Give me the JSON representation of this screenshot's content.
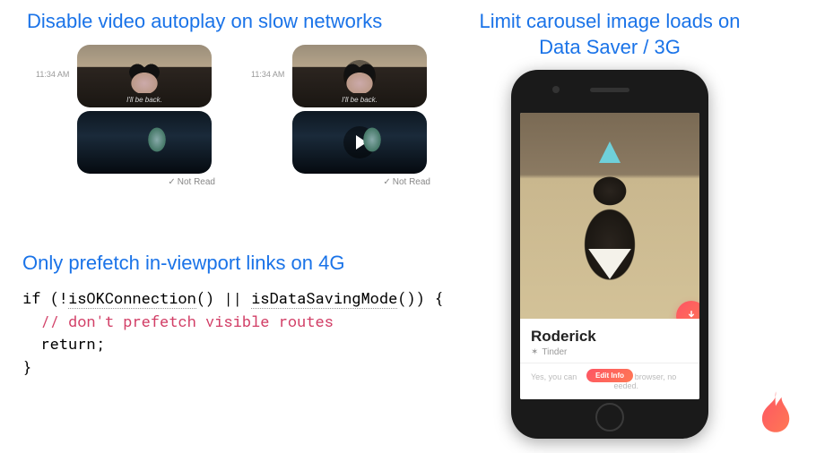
{
  "headings": {
    "autoplay": "Disable video autoplay on slow networks",
    "prefetch": "Only prefetch in-viewport links on 4G",
    "carousel": "Limit carousel image loads on Data Saver / 3G"
  },
  "chat": {
    "timestamp": "11:34 AM",
    "caption1": "I'll be back.",
    "read_status": "Not Read",
    "check_glyph": "✓"
  },
  "code": {
    "l1a": "if (!",
    "l1b": "isOKConnection",
    "l1c": "() || ",
    "l1d": "isDataSavingMode",
    "l1e": "()) {",
    "l2": "  // don't prefetch visible routes",
    "l3": "  return;",
    "l4": "}"
  },
  "tinder": {
    "name": "Roderick",
    "source_glyph": "✶",
    "source": "Tinder",
    "desc_left": "Yes, you can",
    "desc_right": "in your browser, no",
    "desc_tail": "eeded.",
    "pill": "Edit Info"
  }
}
